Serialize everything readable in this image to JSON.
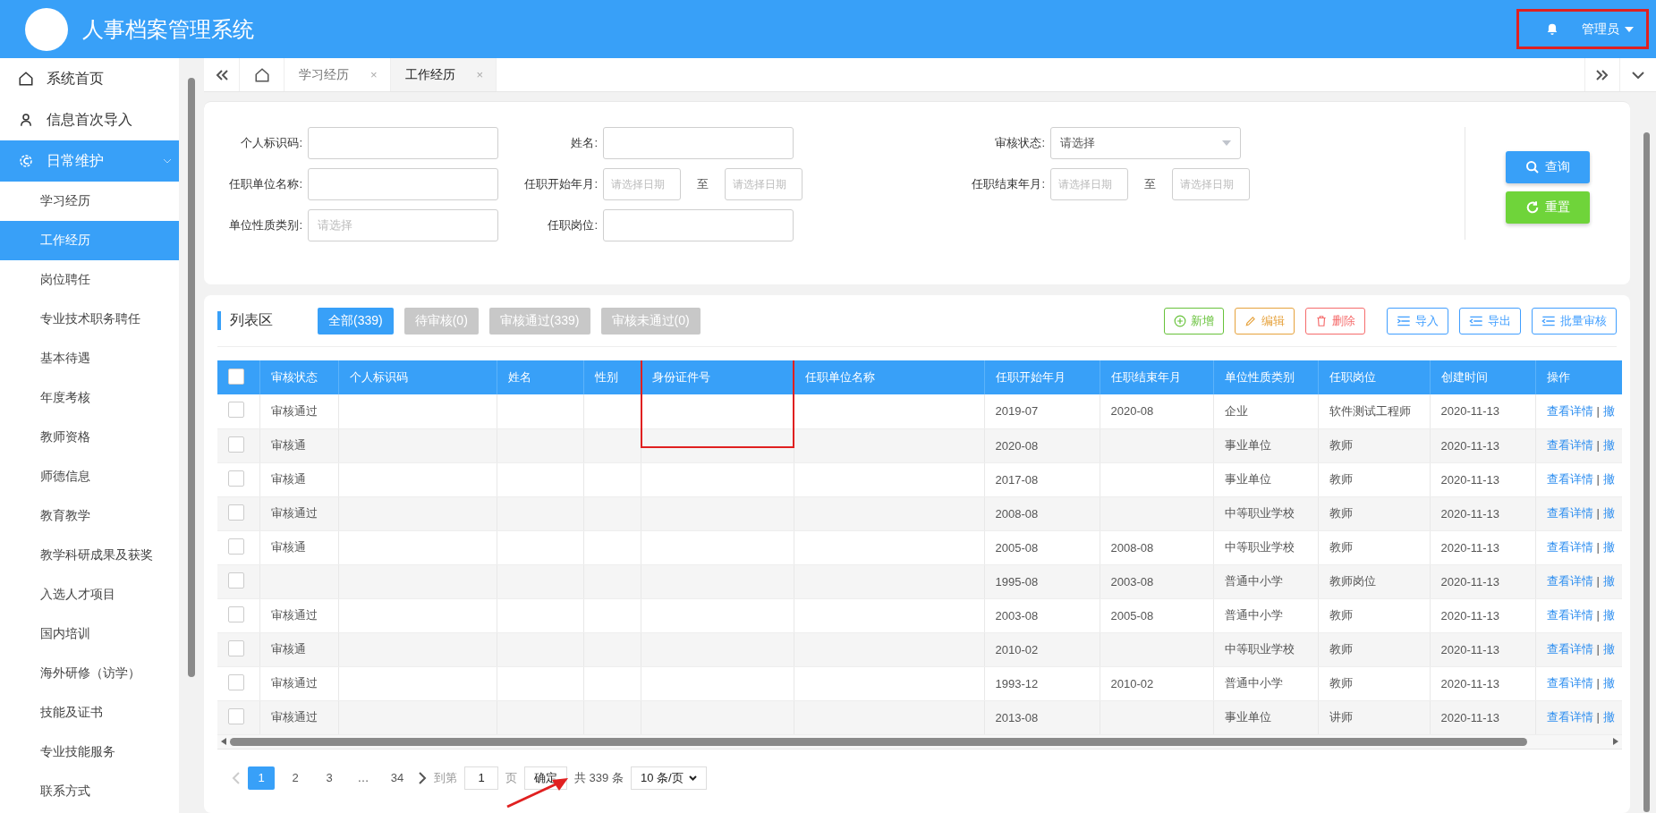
{
  "header": {
    "title": "人事档案管理系统",
    "user": "管理员"
  },
  "sidebar": {
    "items": [
      {
        "label": "系统首页",
        "kind": "home",
        "selected": false
      },
      {
        "label": "信息首次导入",
        "kind": "user",
        "selected": false
      },
      {
        "label": "日常维护",
        "kind": "gear",
        "selected": true,
        "expanded": true,
        "children": [
          {
            "label": "学习经历",
            "selected": false
          },
          {
            "label": "工作经历",
            "selected": true
          },
          {
            "label": "岗位聘任",
            "selected": false
          },
          {
            "label": "专业技术职务聘任",
            "selected": false
          },
          {
            "label": "基本待遇",
            "selected": false
          },
          {
            "label": "年度考核",
            "selected": false
          },
          {
            "label": "教师资格",
            "selected": false
          },
          {
            "label": "师德信息",
            "selected": false
          },
          {
            "label": "教育教学",
            "selected": false
          },
          {
            "label": "教学科研成果及获奖",
            "selected": false
          },
          {
            "label": "入选人才项目",
            "selected": false
          },
          {
            "label": "国内培训",
            "selected": false
          },
          {
            "label": "海外研修（访学）",
            "selected": false
          },
          {
            "label": "技能及证书",
            "selected": false
          },
          {
            "label": "专业技能服务",
            "selected": false
          },
          {
            "label": "联系方式",
            "selected": false
          }
        ]
      }
    ]
  },
  "tabs": [
    {
      "label": "学习经历",
      "selected": false,
      "close": "×"
    },
    {
      "label": "工作经历",
      "selected": true,
      "close": "×"
    }
  ],
  "search": {
    "fields": [
      {
        "label": "个人标识码:",
        "kind": "text"
      },
      {
        "label": "姓名:",
        "kind": "text"
      },
      {
        "label": "审核状态:",
        "kind": "select",
        "placeholder": "请选择"
      },
      {
        "label": "任职单位名称:",
        "kind": "text"
      },
      {
        "label": "任职开始年月:",
        "kind": "daterange",
        "placeholder": "请选择日期",
        "to": "至",
        "placeholder_end": "请选择日期"
      },
      {
        "label": "任职结束年月:",
        "kind": "daterange",
        "placeholder": "请选择日期",
        "to": "至",
        "placeholder_end": "请选择日期"
      },
      {
        "label": "单位性质类别:",
        "kind": "text",
        "placeholder": "请选择"
      },
      {
        "label": "任职岗位:",
        "kind": "text"
      }
    ],
    "buttons": [
      {
        "label": "查询",
        "kind": "search"
      },
      {
        "label": "重置",
        "kind": "reset"
      }
    ]
  },
  "list": {
    "title": "列表区",
    "filters": [
      {
        "label": "全部(339)",
        "selected": true
      },
      {
        "label": "待审核(0)",
        "selected": false
      },
      {
        "label": "审核通过(339)",
        "selected": false
      },
      {
        "label": "审核未通过(0)",
        "selected": false
      }
    ],
    "actions": [
      {
        "label": "新增",
        "kind": "add",
        "color": "#67c23a"
      },
      {
        "label": "编辑",
        "kind": "edit",
        "color": "#e6a23c"
      },
      {
        "label": "删除",
        "kind": "delete",
        "color": "#f56c6c"
      },
      {
        "label": "导入",
        "kind": "import",
        "color": "#409eff"
      },
      {
        "label": "导出",
        "kind": "export",
        "color": "#409eff"
      },
      {
        "label": "批量审核",
        "kind": "batch",
        "color": "#409eff"
      }
    ],
    "select_all_checked": false,
    "columns": [
      "审核状态",
      "个人标识码",
      "姓名",
      "性别",
      "身份证件号",
      "任职单位名称",
      "任职开始年月",
      "任职结束年月",
      "单位性质类别",
      "任职岗位",
      "创建时间",
      "操作"
    ],
    "rows": [
      {
        "checked": false,
        "status": "审核通过",
        "start": "2019-07",
        "end": "2020-08",
        "unit_type": "企业",
        "post": "软件测试工程师",
        "created": "2020-11-13",
        "view": "查看详情",
        "sep": "|",
        "revoke": "撤"
      },
      {
        "checked": false,
        "status": "审核通",
        "start": "2020-08",
        "unit_type": "事业单位",
        "post": "教师",
        "created": "2020-11-13",
        "view": "查看详情",
        "sep": "|",
        "revoke": "撤"
      },
      {
        "checked": false,
        "status": "审核通",
        "start": "2017-08",
        "unit_type": "事业单位",
        "post": "教师",
        "created": "2020-11-13",
        "view": "查看详情",
        "sep": "|",
        "revoke": "撤"
      },
      {
        "checked": false,
        "status": "审核通过",
        "start": "2008-08",
        "unit_type": "中等职业学校",
        "post": "教师",
        "created": "2020-11-13",
        "view": "查看详情",
        "sep": "|",
        "revoke": "撤"
      },
      {
        "checked": false,
        "status": "审核通",
        "start": "2005-08",
        "end": "2008-08",
        "unit_type": "中等职业学校",
        "post": "教师",
        "created": "2020-11-13",
        "view": "查看详情",
        "sep": "|",
        "revoke": "撤"
      },
      {
        "checked": false,
        "start": "1995-08",
        "end": "2003-08",
        "unit_type": "普通中小学",
        "post": "教师岗位",
        "created": "2020-11-13",
        "view": "查看详情",
        "sep": "|",
        "revoke": "撤"
      },
      {
        "checked": false,
        "status": "审核通过",
        "start": "2003-08",
        "end": "2005-08",
        "unit_type": "普通中小学",
        "post": "教师",
        "created": "2020-11-13",
        "view": "查看详情",
        "sep": "|",
        "revoke": "撤"
      },
      {
        "checked": false,
        "status": "审核通",
        "start": "2010-02",
        "unit_type": "中等职业学校",
        "post": "教师",
        "created": "2020-11-13",
        "view": "查看详情",
        "sep": "|",
        "revoke": "撤"
      },
      {
        "checked": false,
        "status": "审核通过",
        "start": "1993-12",
        "end": "2010-02",
        "unit_type": "普通中小学",
        "post": "教师",
        "created": "2020-11-13",
        "view": "查看详情",
        "sep": "|",
        "revoke": "撤"
      },
      {
        "checked": false,
        "status": "审核通过",
        "start": "2013-08",
        "unit_type": "事业单位",
        "post": "讲师",
        "created": "2020-11-13",
        "view": "查看详情",
        "sep": "|",
        "revoke": "撤"
      }
    ],
    "pagination": {
      "pages": [
        {
          "label": "1",
          "selected": true
        },
        {
          "label": "2",
          "selected": false
        },
        {
          "label": "3",
          "selected": false
        },
        {
          "label": "…",
          "selected": false
        },
        {
          "label": "34",
          "selected": false
        }
      ],
      "goto": "到第",
      "page_value": "1",
      "page_unit": "页",
      "confirm": "确定",
      "total": "共 339 条",
      "page_size": "10 条/页"
    }
  }
}
